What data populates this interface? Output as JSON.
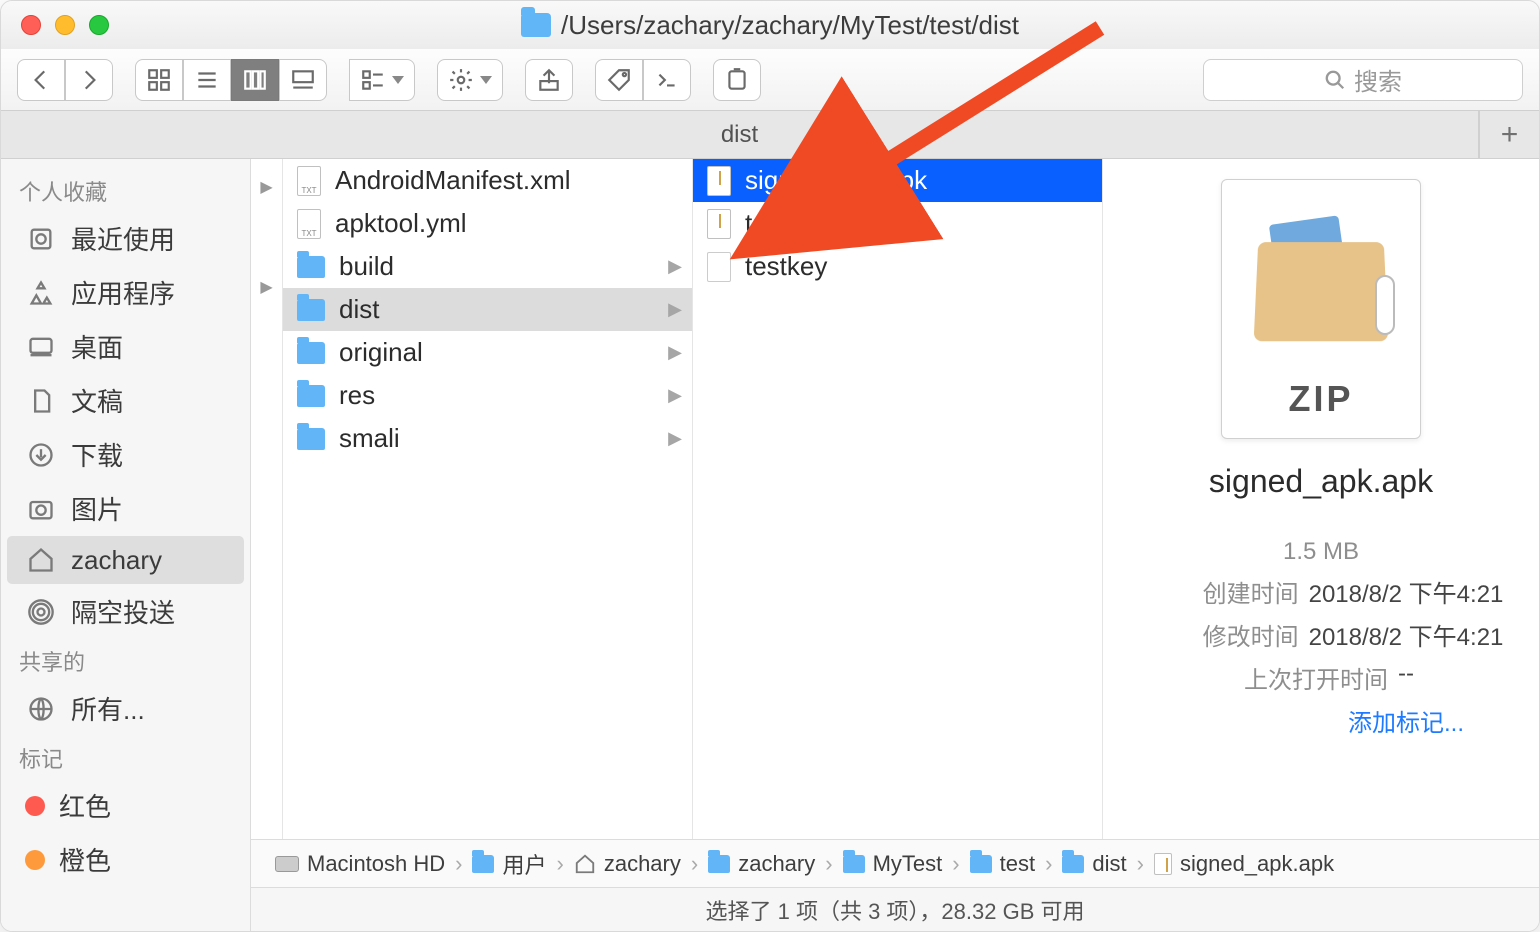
{
  "window": {
    "path": "/Users/zachary/zachary/MyTest/test/dist"
  },
  "tabbar": {
    "tab_label": "dist",
    "add_label": "+"
  },
  "sidebar": {
    "section_favorites": "个人收藏",
    "recent": "最近使用",
    "applications": "应用程序",
    "desktop": "桌面",
    "documents": "文稿",
    "downloads": "下载",
    "pictures": "图片",
    "home": "zachary",
    "airdrop": "隔空投送",
    "section_shared": "共享的",
    "all": "所有...",
    "section_tags": "标记",
    "tag_red": "红色",
    "tag_orange": "橙色"
  },
  "col1": [
    {
      "name": "AndroidManifest.xml",
      "type": "file"
    },
    {
      "name": "apktool.yml",
      "type": "file"
    },
    {
      "name": "build",
      "type": "folder",
      "children": true
    },
    {
      "name": "dist",
      "type": "folder",
      "children": true,
      "selected": true
    },
    {
      "name": "original",
      "type": "folder",
      "children": true
    },
    {
      "name": "res",
      "type": "folder",
      "children": true
    },
    {
      "name": "smali",
      "type": "folder",
      "children": true
    }
  ],
  "col2": [
    {
      "name": "signed_apk.apk",
      "type": "zip",
      "selected": true
    },
    {
      "name": "test.apk",
      "type": "zip"
    },
    {
      "name": "testkey",
      "type": "plain"
    }
  ],
  "preview": {
    "title": "signed_apk.apk",
    "zip_label": "ZIP",
    "size": "1.5 MB",
    "created_k": "创建时间",
    "created_v": "2018/8/2 下午4:21",
    "modified_k": "修改时间",
    "modified_v": "2018/8/2 下午4:21",
    "lastopen_k": "上次打开时间",
    "lastopen_v": "--",
    "addtag": "添加标记..."
  },
  "pathbar": {
    "hd": "Macintosh HD",
    "users": "用户",
    "home": "zachary",
    "p1": "zachary",
    "p2": "MyTest",
    "p3": "test",
    "p4": "dist",
    "file": "signed_apk.apk"
  },
  "status": "选择了 1 项（共 3 项），28.32 GB 可用",
  "search_placeholder": "搜索"
}
